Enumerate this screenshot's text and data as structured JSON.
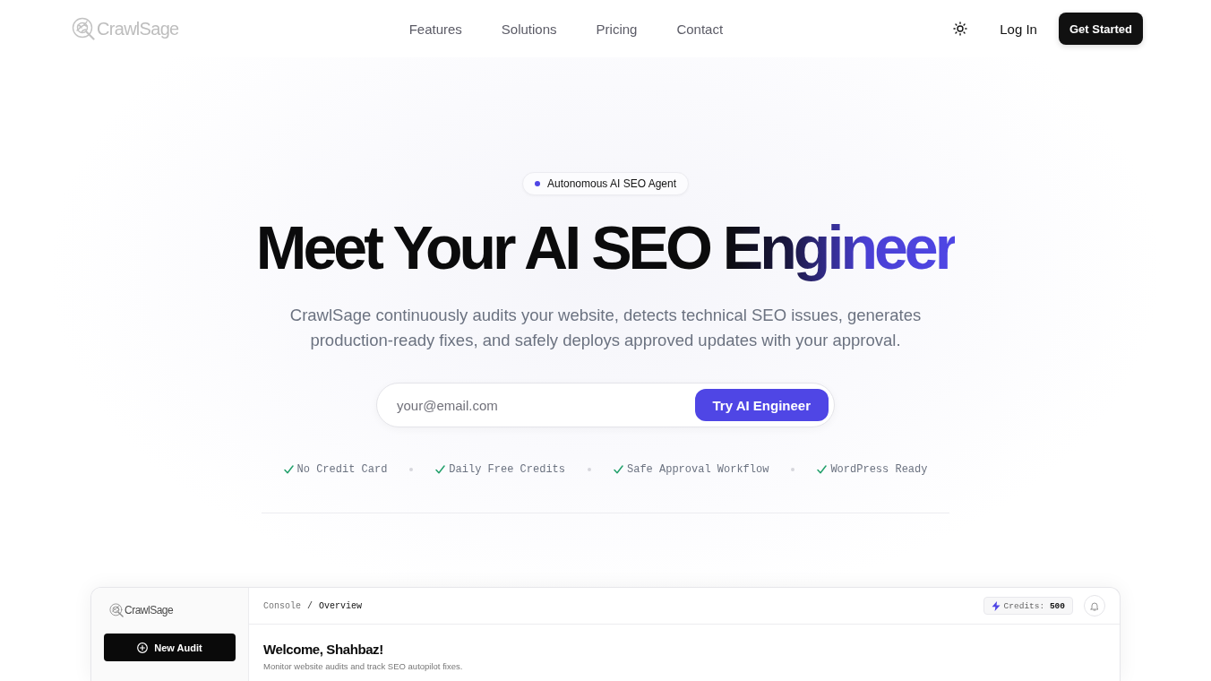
{
  "nav": {
    "logo": "CrawlSage",
    "links": [
      "Features",
      "Solutions",
      "Pricing",
      "Contact"
    ],
    "login": "Log In",
    "cta": "Get Started"
  },
  "hero": {
    "badge": "Autonomous AI SEO Agent",
    "headline": {
      "text": "Meet Your AI SEO",
      "highlight": "Engineer"
    },
    "subtitle": "CrawlSage continuously audits your website, detects technical SEO issues, generates production-ready fixes, and safely deploys approved updates with your approval.",
    "email_form": {
      "placeholder": "your@email.com",
      "button": "Try AI Engineer"
    },
    "perks": [
      "No Credit Card",
      "Daily Free Credits",
      "Safe Approval Workflow",
      "WordPress Ready"
    ]
  },
  "dashboard_preview": {
    "sidebar": {
      "logo": "CrawlSage",
      "new_audit": "New Audit"
    },
    "breadcrumb": {
      "items": [
        {
          "label": "Console",
          "current": false
        },
        {
          "label": "Overview",
          "current": true
        }
      ],
      "separator": "/"
    },
    "credits": "Credits: **500**",
    "welcome": {
      "title": "Welcome, Shahbaz!",
      "subtitle": "Monitor website audits and track SEO autopilot fixes."
    }
  }
}
